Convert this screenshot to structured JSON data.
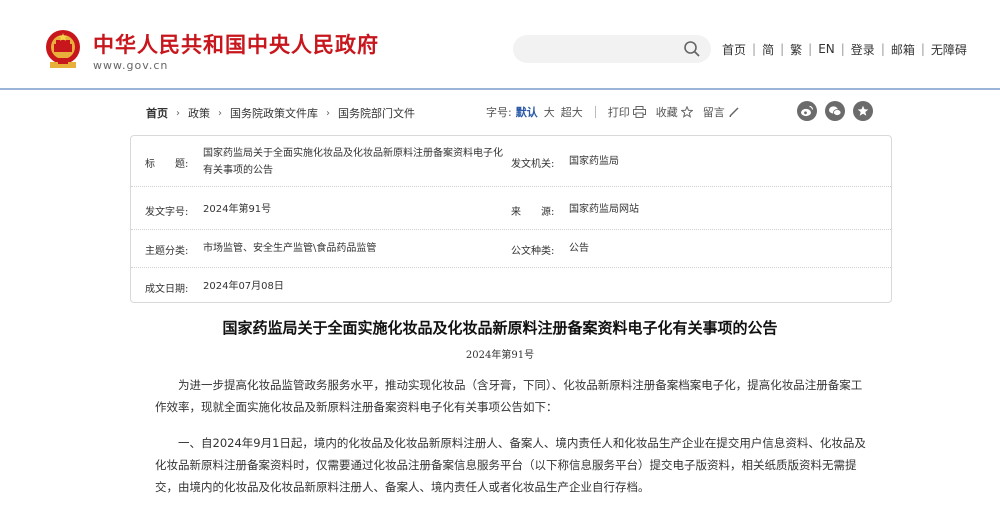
{
  "header": {
    "site_title": "中华人民共和国中央人民政府",
    "site_url": "www.gov.cn",
    "nav": [
      "首页",
      "简",
      "繁",
      "EN",
      "登录",
      "邮箱",
      "无障碍"
    ]
  },
  "breadcrumb": [
    "首页",
    "政策",
    "国务院政策文件库",
    "国务院部门文件"
  ],
  "toolbar": {
    "font_label": "字号:",
    "font_default": "默认",
    "font_large": "大",
    "font_xlarge": "超大",
    "print": "打印",
    "favorite": "收藏",
    "comment": "留言"
  },
  "info": {
    "title_label": "标　　题:",
    "title_value": "国家药监局关于全面实施化妆品及化妆品新原料注册备案资料电子化有关事项的公告",
    "issuer_label": "发文机关:",
    "issuer_value": "国家药监局",
    "doc_no_label": "发文字号:",
    "doc_no_value": "2024年第91号",
    "source_label": "来　　源:",
    "source_value": "国家药监局网站",
    "category_label": "主题分类:",
    "category_value": "市场监管、安全生产监管\\食品药品监管",
    "type_label": "公文种类:",
    "type_value": "公告",
    "date_label": "成文日期:",
    "date_value": "2024年07月08日"
  },
  "article": {
    "title": "国家药监局关于全面实施化妆品及化妆品新原料注册备案资料电子化有关事项的公告",
    "number": "2024年第91号",
    "paragraphs": [
      "为进一步提高化妆品监管政务服务水平，推动实现化妆品（含牙膏，下同）、化妆品新原料注册备案档案电子化，提高化妆品注册备案工作效率，现就全面实施化妆品及新原料注册备案资料电子化有关事项公告如下：",
      "一、自2024年9月1日起，境内的化妆品及化妆品新原料注册人、备案人、境内责任人和化妆品生产企业在提交用户信息资料、化妆品及化妆品新原料注册备案资料时，仅需要通过化妆品注册备案信息服务平台（以下称信息服务平台）提交电子版资料，相关纸质版资料无需提交，由境内的化妆品及化妆品新原料注册人、备案人、境内责任人或者化妆品生产企业自行存档。"
    ]
  },
  "colors": {
    "brand_red": "#c8161d",
    "header_line": "#9bb4d8",
    "link_blue": "#2b5aa7"
  }
}
